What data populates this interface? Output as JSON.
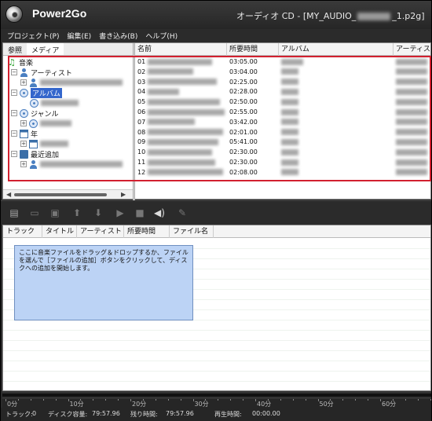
{
  "app": {
    "name": "Power2Go",
    "window_title": "オーディオ CD - [MY_AUDIO_",
    "window_title_suffix": "_1.p2g]"
  },
  "menu": [
    "プロジェクト(P)",
    "編集(E)",
    "書き込み(B)",
    "ヘルプ(H)"
  ],
  "browser": {
    "tabs": [
      "参照",
      "メディア"
    ],
    "tree": {
      "music": "音楽",
      "artist": "アーティスト",
      "album": "アルバム",
      "genre": "ジャンル",
      "year": "年",
      "recent": "最近追加"
    },
    "columns": [
      "名前",
      "所要時間",
      "アルバム",
      "アーティスト"
    ],
    "tracks": [
      {
        "no": "01",
        "duration": "03:05.00"
      },
      {
        "no": "02",
        "duration": "03:04.00"
      },
      {
        "no": "03",
        "duration": "02:25.00"
      },
      {
        "no": "04",
        "duration": "02:28.00"
      },
      {
        "no": "05",
        "duration": "02:50.00"
      },
      {
        "no": "06",
        "duration": "02:55.00"
      },
      {
        "no": "07",
        "duration": "03:42.00"
      },
      {
        "no": "08",
        "duration": "02:01.00"
      },
      {
        "no": "09",
        "duration": "05:41.00"
      },
      {
        "no": "10",
        "duration": "02:30.00"
      },
      {
        "no": "11",
        "duration": "02:30.00"
      },
      {
        "no": "12",
        "duration": "02:08.00"
      }
    ]
  },
  "toolbar": {
    "icons": [
      "add-file-icon",
      "copy-icon",
      "paste-icon",
      "move-up-icon",
      "move-down-icon",
      "play-icon",
      "stop-icon",
      "volume-icon",
      "edit-icon"
    ]
  },
  "compile": {
    "columns": [
      "トラック",
      "タイトル",
      "アーティスト",
      "所要時間",
      "ファイル名"
    ],
    "hint": "ここに音楽ファイルをドラッグ＆ドロップするか、ファイルを選んで［ファイルの追加］ボタンをクリックして、ディスクへの追加を開始します。"
  },
  "scale": [
    "0分",
    "10分",
    "20分",
    "30分",
    "40分",
    "50分",
    "60分"
  ],
  "status": {
    "tracks_label": "トラック:",
    "tracks_value": "0",
    "capacity_label": "ディスク容量:",
    "capacity_value": "79:57.96",
    "remaining_label": "残り時間:",
    "remaining_value": "79:57.96",
    "playback_label": "再生時間:",
    "playback_value": "00:00.00"
  },
  "colors": {
    "highlight": "#d2202f",
    "selection": "#3366cc",
    "hint_bg": "#bcd3f5"
  }
}
